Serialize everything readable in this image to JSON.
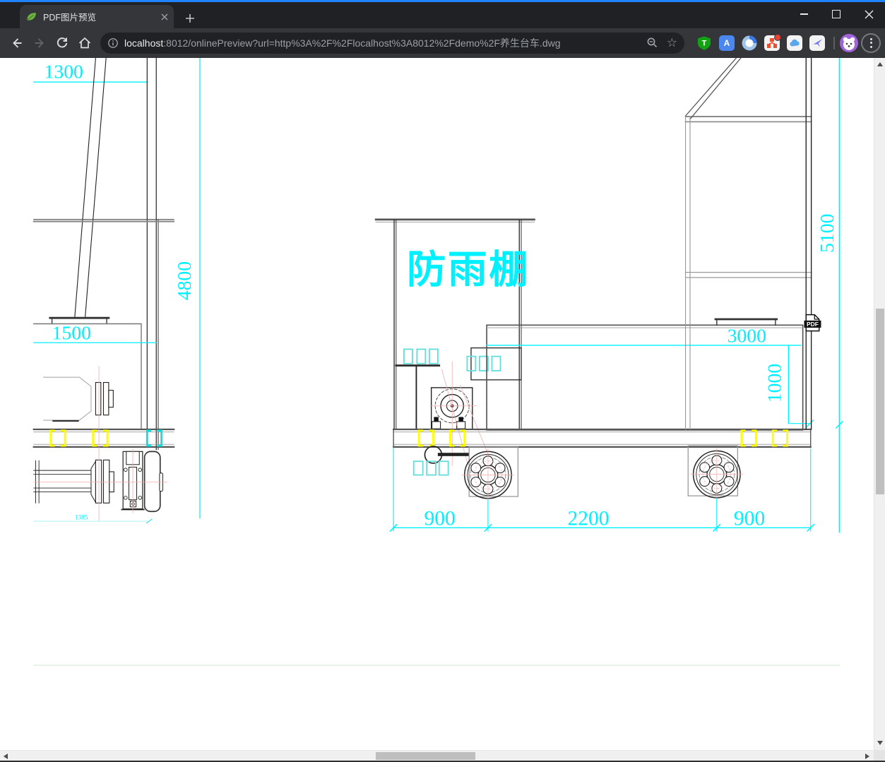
{
  "browser": {
    "accent_color": "#1f83fb",
    "tab": {
      "title": "PDF图片预览"
    },
    "omnibox": {
      "host": "localhost",
      "path": ":8012/onlinePreview?url=http%3A%2F%2Flocalhost%3A8012%2Fdemo%2F养生台车.dwg"
    },
    "icons": {
      "navigation": [
        "back-icon",
        "forward-icon",
        "reload-icon",
        "home-icon"
      ],
      "omnibox": [
        "info-icon",
        "zoom-icon",
        "bookmark-star-icon"
      ],
      "extensions": [
        "tampermonkey-icon",
        "translate-icon",
        "ring-icon",
        "helper-icon",
        "cloud-icon",
        "bird-icon"
      ],
      "profile": "profile-avatar",
      "menu": "kebab-menu-icon",
      "window": [
        "minimize-icon",
        "maximize-icon",
        "close-icon"
      ]
    }
  },
  "drawing": {
    "shelter_label": "防雨棚",
    "pdf_badge": "PDF",
    "dims": {
      "d1300": "1300",
      "d4800": "4800",
      "d1500": "1500",
      "d1385": "1385",
      "d3000": "3000",
      "d1000": "1000",
      "d5100": "5100",
      "d900_left": "900",
      "d2200": "2200",
      "d900_right": "900"
    },
    "colors": {
      "dimension": "#00F0FF",
      "bracket_highlight": "#FFFF00",
      "centerline": "#F0A8A8",
      "line": "#1C1C1C",
      "line_gray": "#8A8A8A"
    }
  }
}
